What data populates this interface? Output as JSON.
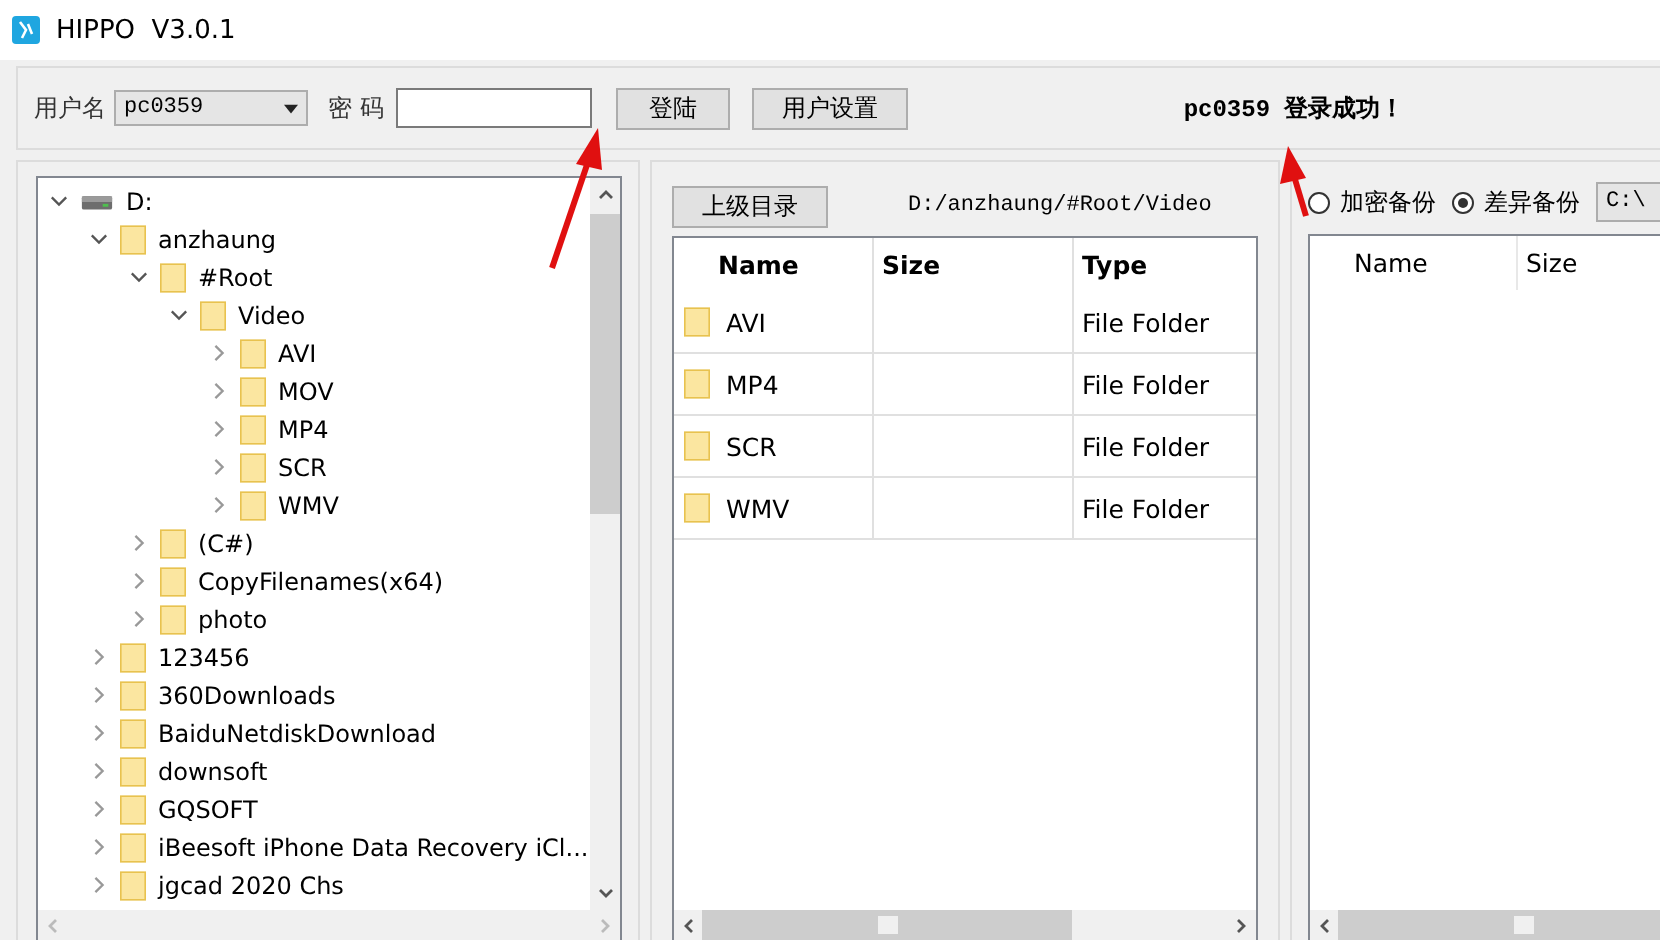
{
  "window": {
    "title": "HIPPO  V3.0.1"
  },
  "login": {
    "username_label": "用户名",
    "username": "pc0359",
    "password_label": "密 码",
    "login_button": "登陆",
    "settings_button": "用户设置",
    "status": "pc0359 登录成功！"
  },
  "tree": {
    "items": [
      {
        "label": "D:",
        "kind": "drive",
        "expanded": true,
        "children": [
          {
            "label": "anzhaung",
            "kind": "folder",
            "expanded": true,
            "children": [
              {
                "label": "#Root",
                "kind": "folder",
                "expanded": true,
                "children": [
                  {
                    "label": "Video",
                    "kind": "folder",
                    "expanded": true,
                    "children": [
                      {
                        "label": "AVI",
                        "kind": "folder",
                        "expanded": false
                      },
                      {
                        "label": "MOV",
                        "kind": "folder",
                        "expanded": false
                      },
                      {
                        "label": "MP4",
                        "kind": "folder",
                        "expanded": false
                      },
                      {
                        "label": "SCR",
                        "kind": "folder",
                        "expanded": false
                      },
                      {
                        "label": "WMV",
                        "kind": "folder",
                        "expanded": false
                      }
                    ]
                  }
                ]
              },
              {
                "label": "(C#)",
                "kind": "folder",
                "expanded": false
              },
              {
                "label": "CopyFilenames(x64)",
                "kind": "folder",
                "expanded": false
              },
              {
                "label": "photo",
                "kind": "folder",
                "expanded": false
              }
            ]
          },
          {
            "label": "123456",
            "kind": "folder",
            "expanded": false
          },
          {
            "label": "360Downloads",
            "kind": "folder",
            "expanded": false
          },
          {
            "label": "BaiduNetdiskDownload",
            "kind": "folder",
            "expanded": false
          },
          {
            "label": "downsoft",
            "kind": "folder",
            "expanded": false
          },
          {
            "label": "GQSOFT",
            "kind": "folder",
            "expanded": false
          },
          {
            "label": "iBeesoft iPhone Data Recovery iCl...",
            "kind": "folder",
            "expanded": false
          },
          {
            "label": "jgcad 2020 Chs",
            "kind": "folder",
            "expanded": false
          }
        ]
      }
    ]
  },
  "browser": {
    "up_button": "上级目录",
    "path": "D:/anzhaung/#Root/Video",
    "columns": [
      "Name",
      "Size",
      "Type"
    ],
    "rows": [
      {
        "name": "AVI",
        "type": "File Folder"
      },
      {
        "name": "MP4",
        "type": "File Folder"
      },
      {
        "name": "SCR",
        "type": "File Folder"
      },
      {
        "name": "WMV",
        "type": "File Folder"
      }
    ]
  },
  "backup": {
    "options": [
      {
        "label": "加密备份",
        "selected": false
      },
      {
        "label": "差异备份",
        "selected": true
      }
    ],
    "path": "C:\\",
    "columns": [
      "Name",
      "Size"
    ]
  }
}
